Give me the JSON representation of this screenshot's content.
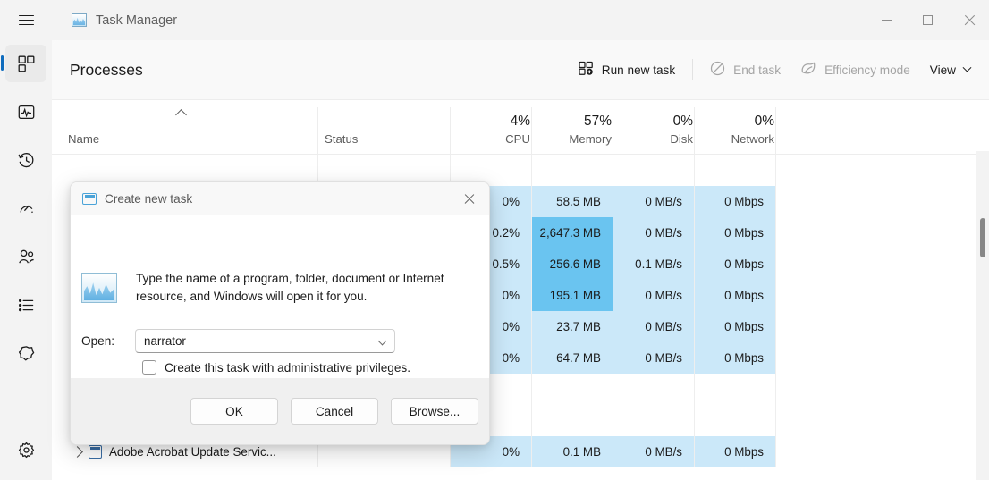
{
  "window": {
    "title": "Task Manager",
    "app_icon": "task-manager-icon",
    "menu_icon": "hamburger-menu-icon",
    "controls": {
      "minimize": "minimize-icon",
      "maximize": "maximize-icon",
      "close": "close-icon"
    }
  },
  "sidebar": {
    "items": [
      {
        "name": "processes",
        "icon": "processes-icon",
        "selected": true
      },
      {
        "name": "performance",
        "icon": "performance-icon",
        "selected": false
      },
      {
        "name": "app-history",
        "icon": "history-clock-icon",
        "selected": false
      },
      {
        "name": "startup-apps",
        "icon": "startup-speedometer-icon",
        "selected": false
      },
      {
        "name": "users",
        "icon": "users-icon",
        "selected": false
      },
      {
        "name": "details",
        "icon": "details-list-icon",
        "selected": false
      },
      {
        "name": "services",
        "icon": "services-gear-cog-icon",
        "selected": false
      }
    ],
    "settings": {
      "name": "settings",
      "icon": "settings-gear-icon"
    }
  },
  "toolbar": {
    "page_title": "Processes",
    "run_new_task": "Run new task",
    "end_task": "End task",
    "efficiency_mode": "Efficiency mode",
    "view": "View",
    "run_new_task_icon": "add-window-icon",
    "end_task_icon": "prohibition-circle-icon",
    "efficiency_mode_icon": "leaf-icon",
    "view_chevron_icon": "chevron-down-icon"
  },
  "table": {
    "columns": [
      {
        "key": "name",
        "label": "Name",
        "value": "",
        "sorted": "asc"
      },
      {
        "key": "status",
        "label": "Status",
        "value": ""
      },
      {
        "key": "cpu",
        "label": "CPU",
        "value": "4%"
      },
      {
        "key": "memory",
        "label": "Memory",
        "value": "57%"
      },
      {
        "key": "disk",
        "label": "Disk",
        "value": "0%"
      },
      {
        "key": "network",
        "label": "Network",
        "value": "0%"
      }
    ],
    "rows": [
      {
        "name": "",
        "status": "",
        "cpu": "",
        "memory": "",
        "disk": "",
        "network": "",
        "highlight": false,
        "heat": false
      },
      {
        "name": "",
        "status": "",
        "cpu": "0%",
        "memory": "58.5 MB",
        "disk": "0 MB/s",
        "network": "0 Mbps",
        "highlight": true,
        "heat": false
      },
      {
        "name": "",
        "status": "",
        "cpu": "0.2%",
        "memory": "2,647.3 MB",
        "disk": "0 MB/s",
        "network": "0 Mbps",
        "highlight": true,
        "heat": true
      },
      {
        "name": "",
        "status": "",
        "cpu": "0.5%",
        "memory": "256.6 MB",
        "disk": "0.1 MB/s",
        "network": "0 Mbps",
        "highlight": true,
        "heat": true
      },
      {
        "name": "",
        "status": "",
        "cpu": "0%",
        "memory": "195.1 MB",
        "disk": "0 MB/s",
        "network": "0 Mbps",
        "highlight": true,
        "heat": true
      },
      {
        "name": "",
        "status": "",
        "cpu": "0%",
        "memory": "23.7 MB",
        "disk": "0 MB/s",
        "network": "0 Mbps",
        "highlight": true,
        "heat": false
      },
      {
        "name": "",
        "status": "",
        "cpu": "0%",
        "memory": "64.7 MB",
        "disk": "0 MB/s",
        "network": "0 Mbps",
        "highlight": true,
        "heat": false
      },
      {
        "name": "",
        "status": "",
        "cpu": "",
        "memory": "",
        "disk": "",
        "network": "",
        "highlight": false,
        "heat": false
      },
      {
        "name": "",
        "status": "",
        "cpu": "",
        "memory": "",
        "disk": "",
        "network": "",
        "highlight": false,
        "heat": false
      },
      {
        "name": "Adobe Acrobat Update Servic...",
        "status": "",
        "cpu": "0%",
        "memory": "0.1 MB",
        "disk": "0 MB/s",
        "network": "0 Mbps",
        "highlight": true,
        "heat": false
      }
    ]
  },
  "dialog": {
    "title": "Create new task",
    "title_icon": "window-icon",
    "close_icon": "close-icon",
    "app_icon": "task-manager-icon",
    "description": "Type the name of a program, folder, document or Internet resource, and Windows will open it for you.",
    "open_label": "Open:",
    "input_value": "narrator",
    "input_chevron_icon": "chevron-down-icon",
    "checkbox_label": "Create this task with administrative privileges.",
    "checkbox_checked": false,
    "buttons": {
      "ok": "OK",
      "cancel": "Cancel",
      "browse": "Browse..."
    }
  },
  "colors": {
    "accent": "#0f6cbd",
    "row_highlight": "#cbe8f9",
    "heat_cell": "#6ac4f0"
  }
}
